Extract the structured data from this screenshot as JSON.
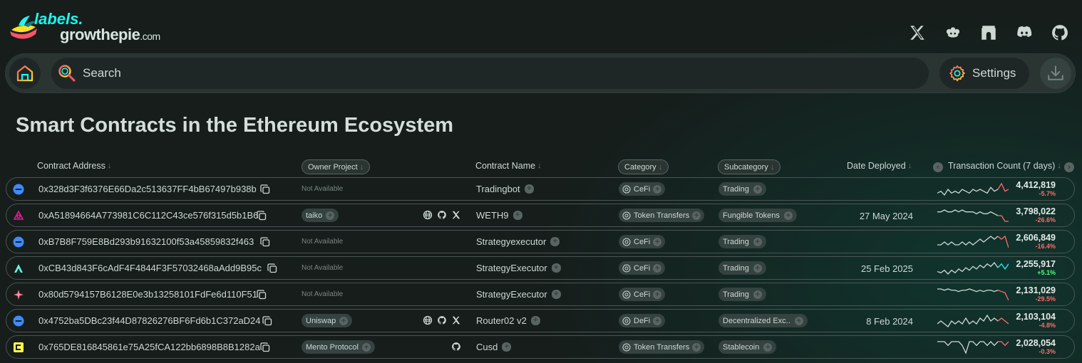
{
  "brand": {
    "labels": "labels.",
    "name": "growthepie",
    "tld": ".com"
  },
  "socials": [
    "x-icon",
    "lens-icon",
    "farcaster-icon",
    "discord-icon",
    "github-icon"
  ],
  "search": {
    "placeholder": "Search"
  },
  "settings": {
    "label": "Settings"
  },
  "page_title": "Smart Contracts in the Ethereum Ecosystem",
  "columns": {
    "address": "Contract Address",
    "owner": "Owner Project",
    "name": "Contract Name",
    "category": "Category",
    "subcategory": "Subcategory",
    "date": "Date Deployed",
    "txcount": "Transaction Count (7 days)"
  },
  "colors": {
    "accent": "#1DF7EF",
    "negative": "#ff6b6b",
    "positive": "#4CFF7E",
    "row_border": "#4a5552",
    "pill_bg": "#344240"
  },
  "rows": [
    {
      "chain": "ethereum",
      "address": "0x328d3F3f6376E66Da2c513637FF4bB67497b938b",
      "owner": "Not Available",
      "links": [],
      "name": "Tradingbot",
      "category": "CeFi",
      "subcategory": "Trading",
      "date": "",
      "tx": "4,412,819",
      "change": "-5.7%",
      "trend": [
        10,
        11,
        9,
        12,
        10,
        11,
        10,
        12,
        11,
        10,
        12,
        11,
        12,
        11,
        10,
        13,
        11,
        12,
        15,
        11,
        12
      ]
    },
    {
      "chain": "taiko",
      "address": "0xA51894664A773981C6C112C43ce576f315d5b1B6",
      "owner": "taiko",
      "links": [
        "website",
        "github",
        "x"
      ],
      "name": "WETH9",
      "category": "Token Transfers",
      "subcategory": "Fungible Tokens",
      "date": "27 May 2024",
      "tx": "3,798,022",
      "change": "-26.6%",
      "trend": [
        14,
        14,
        15,
        14,
        14,
        15,
        14,
        15,
        14,
        14,
        14,
        13,
        14,
        13,
        13,
        14,
        13,
        12,
        12,
        9,
        9
      ]
    },
    {
      "chain": "ethereum",
      "address": "0xB7B8F759E8Bd293b91632100f53a45859832f463",
      "owner": "Not Available",
      "links": [],
      "name": "Strategyexecutor",
      "category": "CeFi",
      "subcategory": "Trading",
      "date": "",
      "tx": "2,606,849",
      "change": "-16.4%",
      "trend": [
        9,
        9,
        10,
        9,
        10,
        9,
        9,
        10,
        9,
        10,
        9,
        10,
        11,
        10,
        11,
        12,
        11,
        12,
        11,
        12,
        8
      ]
    },
    {
      "chain": "zksync",
      "address": "0xCB43d843F6cAdF4F4844F3F57032468aAdd9B95c",
      "owner": "Not Available",
      "links": [],
      "name": "StrategyExecutor",
      "category": "CeFi",
      "subcategory": "Trading",
      "date": "25 Feb 2025",
      "tx": "2,255,917",
      "change": "+5.1%",
      "trend": [
        8,
        7,
        9,
        6,
        9,
        7,
        10,
        8,
        11,
        9,
        12,
        10,
        13,
        11,
        14,
        12,
        15,
        11,
        14,
        10,
        14
      ]
    },
    {
      "chain": "starknet",
      "address": "0x80d5794157B6128E0e3b13258101FdFe6d110F51",
      "owner": "Not Available",
      "links": [],
      "name": "StrategyExecutor",
      "category": "CeFi",
      "subcategory": "Trading",
      "date": "",
      "tx": "2,131,029",
      "change": "-29.5%",
      "trend": [
        15,
        15,
        14,
        15,
        14,
        14,
        13,
        14,
        14,
        15,
        14,
        13,
        14,
        13,
        14,
        14,
        13,
        14,
        13,
        12,
        6
      ]
    },
    {
      "chain": "ethereum",
      "address": "0x4752ba5DBc23f44D87826276BF6Fd6b1C372aD24",
      "owner": "Uniswap",
      "links": [
        "website",
        "github",
        "x"
      ],
      "name": "Router02 v2",
      "category": "DeFi",
      "subcategory": "Decentralized Exc..",
      "date": "8 Feb 2024",
      "tx": "2,103,104",
      "change": "-4.8%",
      "trend": [
        10,
        11,
        10,
        9,
        11,
        10,
        11,
        10,
        12,
        10,
        11,
        10,
        12,
        11,
        13,
        11,
        12,
        11,
        12,
        11,
        10
      ]
    },
    {
      "chain": "celo",
      "address": "0x765DE816845861e75A25fCA122bb6898B8B1282a",
      "owner": "Mento Protocol",
      "links": [
        "github"
      ],
      "name": "Cusd",
      "category": "Token Transfers",
      "subcategory": "Stablecoin",
      "date": "",
      "tx": "2,028,054",
      "change": "-0.3%",
      "trend": [
        12,
        12,
        12,
        11,
        12,
        12,
        12,
        11,
        9,
        12,
        12,
        11,
        12,
        12,
        11,
        12,
        11,
        12,
        12,
        11,
        12
      ]
    }
  ]
}
